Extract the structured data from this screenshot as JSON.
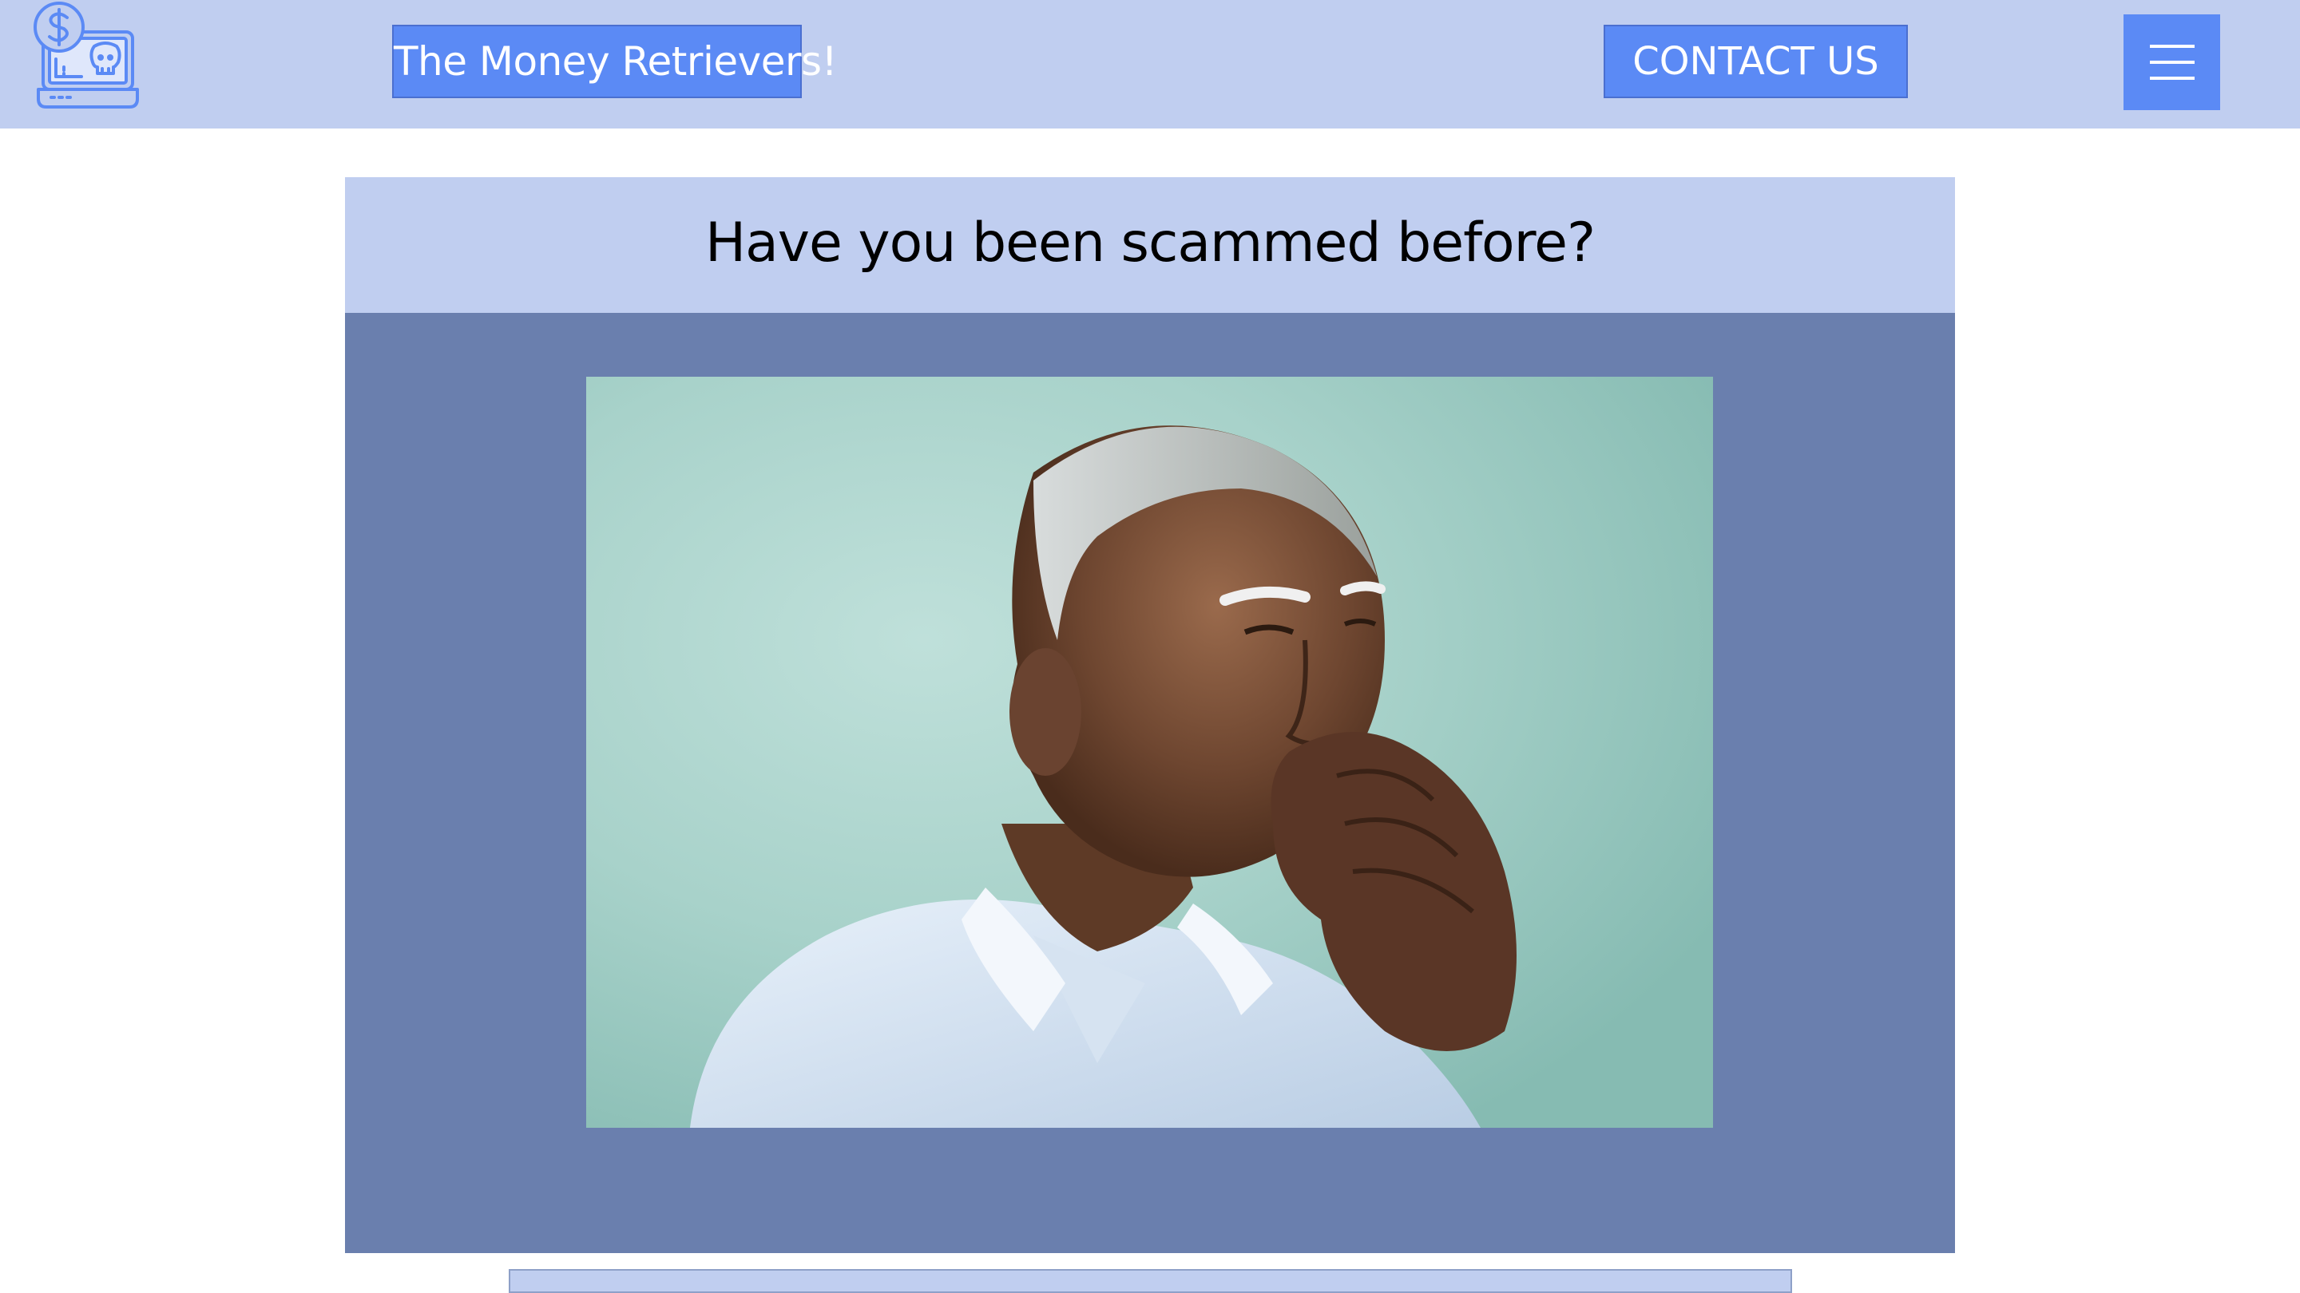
{
  "header": {
    "logo_icon": "money-scam-laptop-icon",
    "brand_label": "The Money Retrievers!",
    "contact_label": "CONTACT US",
    "menu_icon": "hamburger-menu-icon"
  },
  "main": {
    "title": "Have you been scammed before?",
    "hero_image": "elderly-man-thinking-photo"
  },
  "colors": {
    "header_bg": "#c0cef0",
    "button_bg": "#5b8af5",
    "card_body_bg": "#6a7fae"
  }
}
